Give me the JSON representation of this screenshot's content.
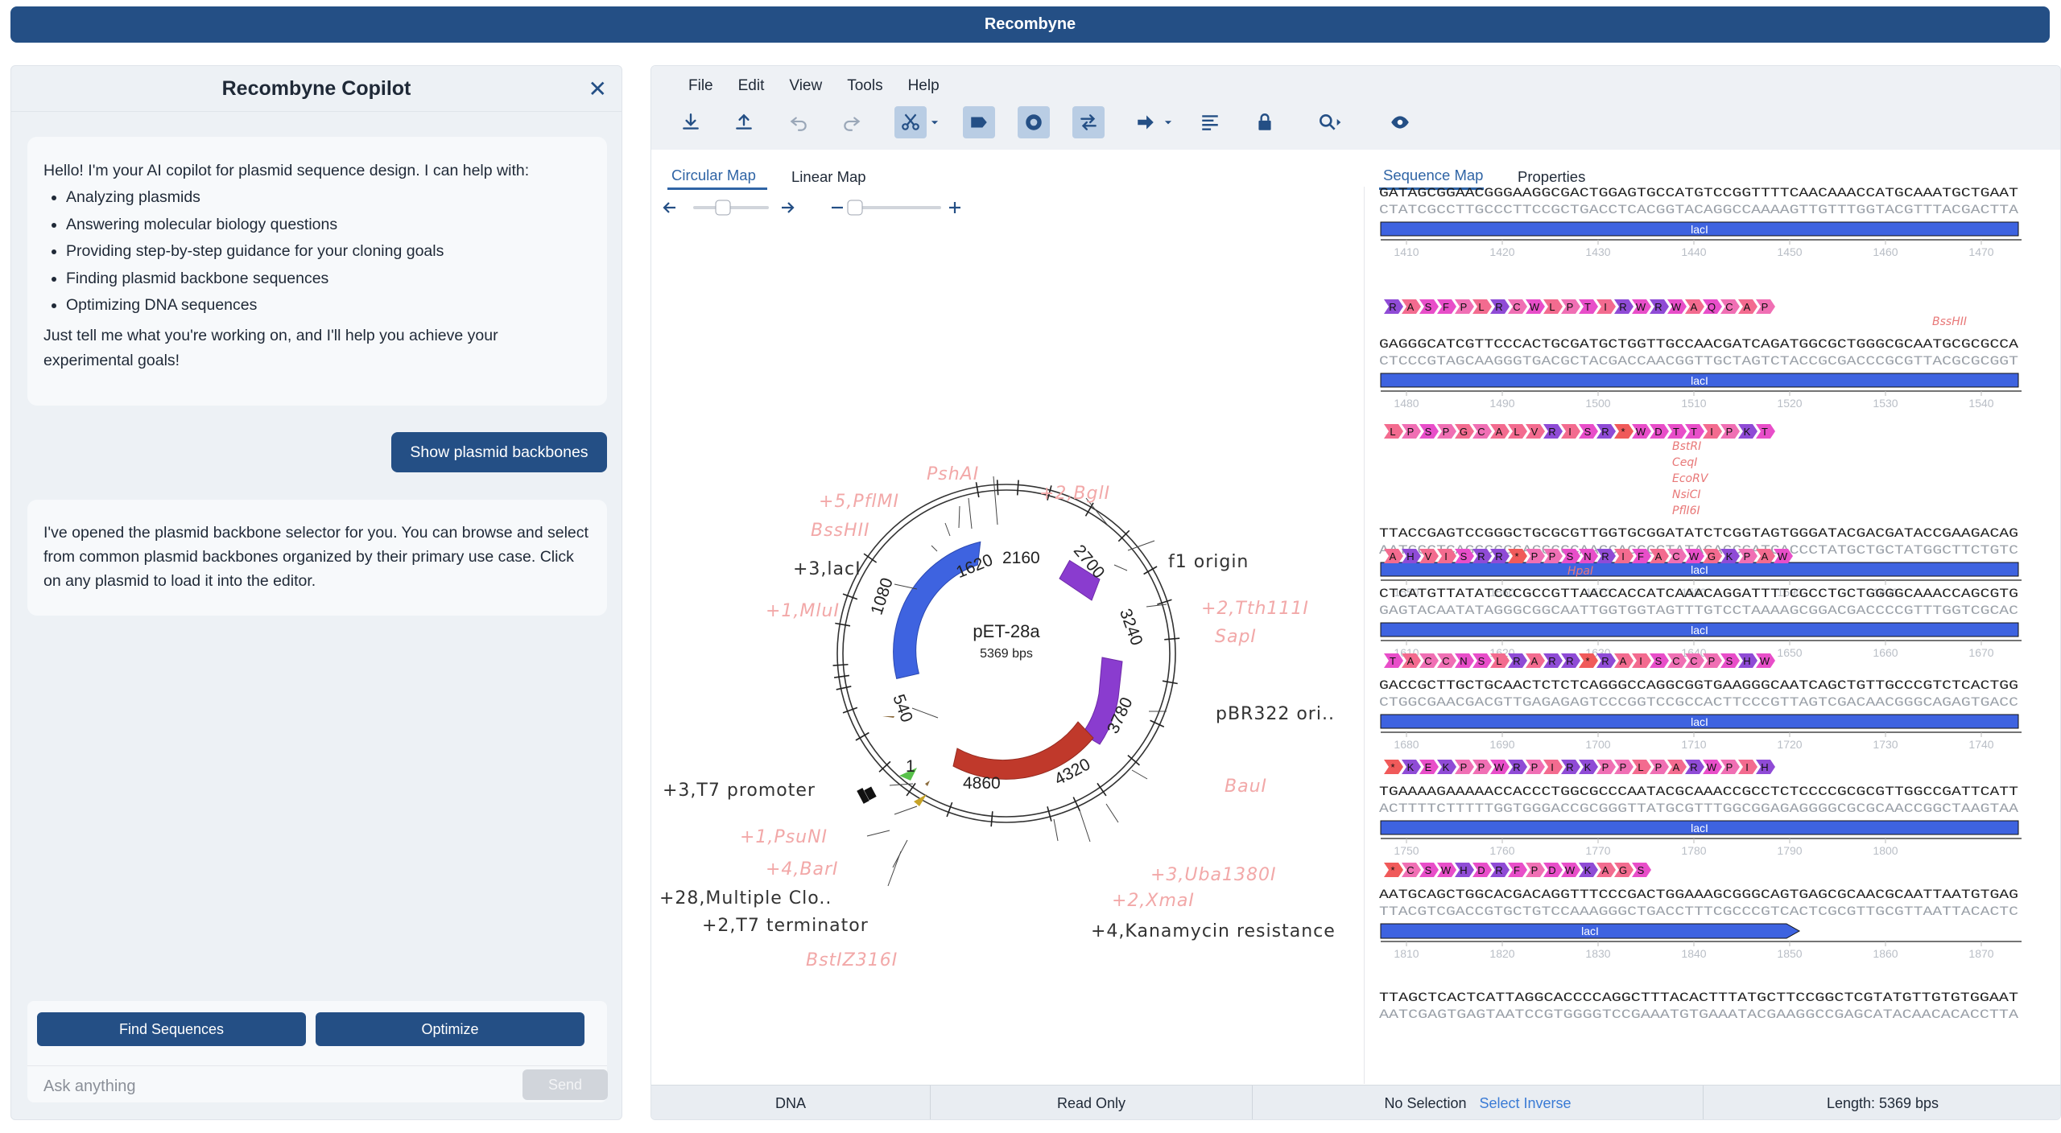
{
  "app": {
    "title": "Recombyne"
  },
  "copilot": {
    "title": "Recombyne Copilot",
    "close_icon": "close-icon",
    "intro": "Hello! I'm your AI copilot for plasmid sequence design. I can help with:",
    "capabilities": [
      "Analyzing plasmids",
      "Answering molecular biology questions",
      "Providing step-by-step guidance for your cloning goals",
      "Finding plasmid backbone sequences",
      "Optimizing DNA sequences"
    ],
    "outro": "Just tell me what you're working on, and I'll help you achieve your experimental goals!",
    "user_message": "Show plasmid backbones",
    "reply": "I've opened the plasmid backbone selector for you. You can browse and select from common plasmid backbones organized by their primary use case. Click on any plasmid to load it into the editor.",
    "find_button": "Find Sequences",
    "optimize_button": "Optimize",
    "input_placeholder": "Ask anything",
    "send_button": "Send"
  },
  "menu": [
    "File",
    "Edit",
    "View",
    "Tools",
    "Help"
  ],
  "toolbar": [
    "download-icon",
    "upload-icon",
    "undo-icon",
    "redo-icon",
    "cut-icon",
    "feature-label-icon",
    "circular-view-icon",
    "swap-icon",
    "arrow-right-icon",
    "align-icon",
    "lock-icon",
    "search-icon",
    "eye-icon"
  ],
  "tabs": {
    "circular": "Circular Map",
    "linear": "Linear Map",
    "sequence": "Sequence Map",
    "properties": "Properties"
  },
  "plasmid": {
    "name": "pET-28a",
    "size": "5369 bps",
    "ticks": [
      "1620",
      "2160",
      "2700",
      "3240",
      "3780",
      "4320",
      "4860",
      "1",
      "540",
      "1080"
    ],
    "features": [
      "+3,lacI",
      "f1 origin",
      "pBR322 ori..",
      "+4,Kanamycin resistance",
      "+3,T7 promoter",
      "+28,Multiple Clo..",
      "+2,T7 terminator"
    ],
    "enzymes": [
      "PshAI",
      "+2,BglI",
      "+5,PflMI",
      "BssHII",
      "+1,MluI",
      "+2,Tth111I",
      "SapI",
      "BauI",
      "+1,PsuNI",
      "+4,BarI",
      "BstIZ316I",
      "+3,Uba1380I",
      "+2,XmaI"
    ]
  },
  "sequence_rows": [
    {
      "aa": [],
      "top": "GATAGCGGAACGGGAAGGCGACTGGAGTGCCATGTCCGGTTTTCAACAAACCATGCAAATGCTGAAT",
      "bottom": "CTATCGCCTTGCCCTTCCGCTGACCTCACGGTACAGGCCAAAAGTTGTTTGGTACGTTTACGACTTA",
      "feature": "lacI",
      "ruler": [
        "1410",
        "1420",
        "1430",
        "1440",
        "1450",
        "1460",
        "1470"
      ],
      "enzymes": []
    },
    {
      "aa": [
        "R",
        "A",
        "S",
        "F",
        "P",
        "L",
        "R",
        "C",
        "W",
        "L",
        "P",
        "T",
        "I",
        "R",
        "W",
        "R",
        "W",
        "A",
        "Q",
        "C",
        "A",
        "P"
      ],
      "top": "GAGGGCATCGTTCCCACTGCGATGCTGGTTGCCAACGATCAGATGGCGCTGGGCGCAATGCGCGCCA",
      "bottom": "CTCCCGTAGCAAGGGTGACGCTACGACCAACGGTTGCTAGTCTACCGCGACCCGCGTTACGCGCGGT",
      "feature": "lacI",
      "ruler": [
        "1480",
        "1490",
        "1500",
        "1510",
        "1520",
        "1530",
        "1540"
      ],
      "enzymes": [
        "BssHII"
      ]
    },
    {
      "aa": [
        "L",
        "P",
        "S",
        "P",
        "G",
        "C",
        "A",
        "L",
        "V",
        "R",
        "I",
        "S",
        "R",
        "*",
        "W",
        "D",
        "T",
        "T",
        "I",
        "P",
        "K",
        "T"
      ],
      "top": "TTACCGAGTCCGGGCTGCGCGTTGGTGCGGATATCTCGGTAGTGGGATACGACGATACCGAAGACAG",
      "bottom": "AATGGCTCAGGCCCGACGCGCAACCACGCCTATAGAGCCATCACCCTATGCTGCTATGGCTTCTGTC",
      "feature": "lacI",
      "ruler": [
        "1550",
        "1560",
        "1570",
        "1580",
        "1590",
        "1600"
      ],
      "enzymes": [
        "BstRI",
        "CeqI",
        "EcoRV",
        "NsiCI",
        "PflI6I"
      ]
    },
    {
      "aa": [
        "A",
        "H",
        "V",
        "I",
        "S",
        "R",
        "R",
        "*",
        "P",
        "P",
        "S",
        "N",
        "R",
        "I",
        "F",
        "A",
        "C",
        "W",
        "G",
        "K",
        "P",
        "A",
        "W"
      ],
      "top": "CTCATGTTATATCCCGCCGTTAACCACCATCAAACAGGATTTTCGCCTGCTGGGGCAAACCAGCGTG",
      "bottom": "GAGTACAATATAGGGCGGCAATTGGTGGTAGTTTGTCCTAAAAGCGGACGACCCCGTTTGGTCGCAC",
      "feature": "lacI",
      "ruler": [
        "1610",
        "1620",
        "1630",
        "1640",
        "1650",
        "1660",
        "1670"
      ],
      "enzymes": [
        "HpaI"
      ]
    },
    {
      "aa": [
        "T",
        "A",
        "C",
        "C",
        "N",
        "S",
        "L",
        "R",
        "A",
        "R",
        "R",
        "*",
        "R",
        "A",
        "I",
        "S",
        "C",
        "C",
        "P",
        "S",
        "H",
        "W"
      ],
      "top": "GACCGCTTGCTGCAACTCTCTCAGGGCCAGGCGGTGAAGGGCAATCAGCTGTTGCCCGTCTCACTGG",
      "bottom": "CTGGCGAACGACGTTGAGAGAGTCCCGGTCCGCCACTTCCCGTTAGTCGACAACGGGCAGAGTGACC",
      "feature": "lacI",
      "ruler": [
        "1680",
        "1690",
        "1700",
        "1710",
        "1720",
        "1730",
        "1740"
      ],
      "enzymes": []
    },
    {
      "aa": [
        "*",
        "K",
        "E",
        "K",
        "P",
        "P",
        "W",
        "R",
        "P",
        "I",
        "R",
        "K",
        "P",
        "P",
        "L",
        "P",
        "A",
        "R",
        "W",
        "P",
        "I",
        "H"
      ],
      "top": "TGAAAAGAAAAACCACCCTGGCGCCCAATACGCAAACCGCCTCTCCCCGCGCGTTGGCCGATTCATT",
      "bottom": "ACTTTTCTTTTTGGTGGGACCGCGGGTTATGCGTTTGGCGGAGAGGGGCGCGCAACCGGCTAAGTAA",
      "feature": "lacI",
      "ruler": [
        "1750",
        "1760",
        "1770",
        "1780",
        "1790",
        "1800"
      ],
      "enzymes": []
    },
    {
      "aa": [
        "*",
        "C",
        "S",
        "W",
        "H",
        "D",
        "R",
        "F",
        "P",
        "D",
        "W",
        "K",
        "A",
        "G",
        "S"
      ],
      "top": "AATGCAGCTGGCACGACAGGTTTCCCGACTGGAAAGCGGGCAGTGAGCGCAACGCAATTAATGTGAG",
      "bottom": "TTACGTCGACCGTGCTGTCCAAAGGGCTGACCTTTCGCCCGTCACTCGCGTTGCGTTAATTACACTC",
      "feature": "lacI",
      "ruler": [
        "1810",
        "1820",
        "1830",
        "1840",
        "1850",
        "1860",
        "1870"
      ],
      "enzymes": []
    },
    {
      "aa": [],
      "top": "TTAGCTCACTCATTAGGCACCCCAGGCTTTACACTTTATGCTTCCGGCTCGTATGTTGTGTGGAAT",
      "bottom": "AATCGAGTGAGTAATCCGTGGGGTCCGAAATGTGAAATACGAAGGCCGAGCATACAACACACCTTA",
      "feature": "",
      "ruler": [],
      "enzymes": []
    }
  ],
  "status": {
    "type": "DNA",
    "mode": "Read Only",
    "selection": "No Selection",
    "select_inverse": "Select Inverse",
    "length": "Length: 5369 bps"
  },
  "colors": {
    "brand": "#244f85",
    "lacI": "#3e63e0",
    "f1": "#8a3ccf",
    "kan": "#c0392b",
    "enzyme": "#f2a8a8"
  }
}
